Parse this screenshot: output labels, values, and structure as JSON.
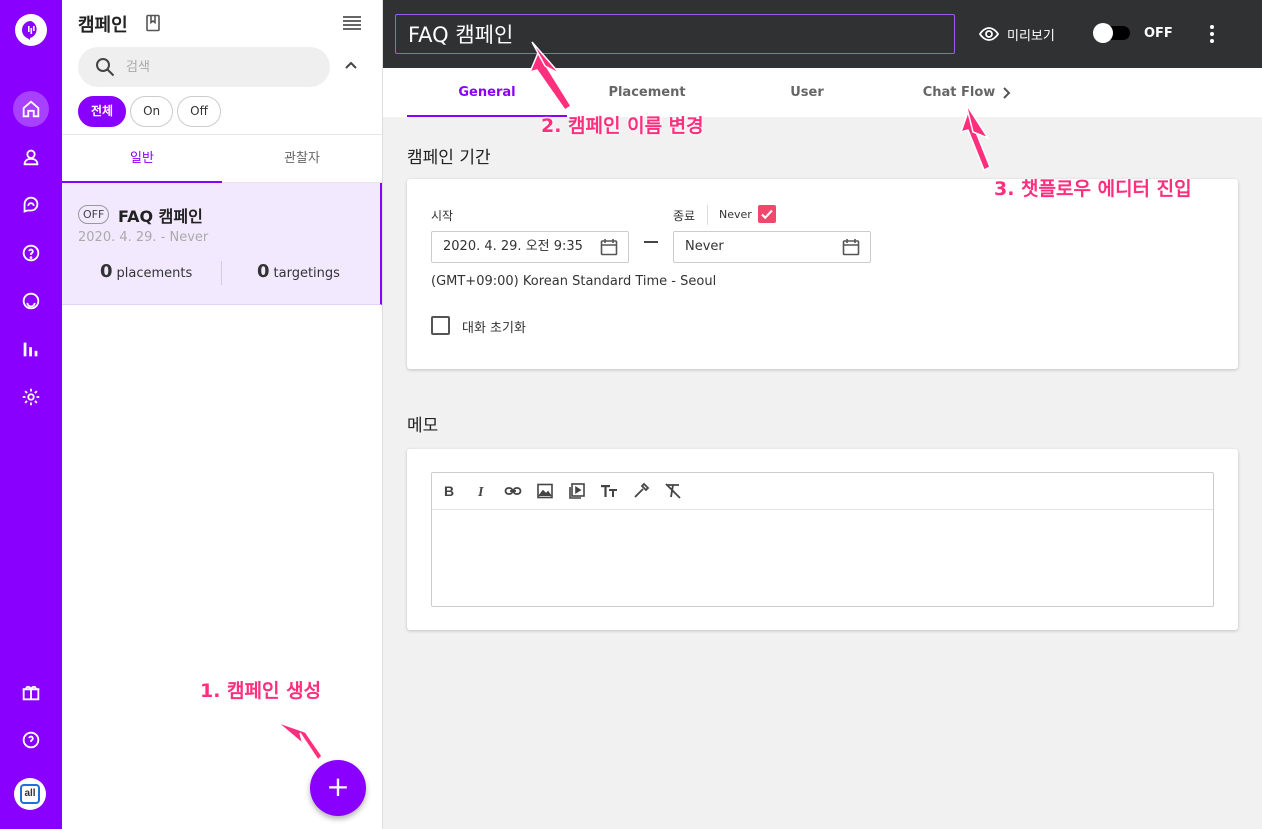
{
  "rail": {
    "items": [
      "home",
      "user",
      "chat-bubble",
      "faq",
      "search-chat",
      "analytics",
      "settings"
    ],
    "bottom": [
      "gift",
      "help"
    ],
    "avatar_text": "all",
    "accent": "#8a00ff"
  },
  "panel": {
    "title": "캠페인",
    "search_placeholder": "검색",
    "filters": [
      "전체",
      "On",
      "Off"
    ],
    "tabs": [
      "일반",
      "관찰자"
    ],
    "campaign": {
      "status": "OFF",
      "name": "FAQ 캠페인",
      "date": "2020. 4. 29. - Never",
      "placements_count": "0",
      "placements_label": "placements",
      "targetings_count": "0",
      "targetings_label": "targetings"
    },
    "add_label": "+"
  },
  "topbar": {
    "title_value": "FAQ 캠페인",
    "preview_label": "미리보기",
    "toggle_label": "OFF"
  },
  "tabs": [
    "General",
    "Placement",
    "User",
    "Chat Flow"
  ],
  "period": {
    "section_title": "캠페인 기간",
    "start_label": "시작",
    "start_value": "2020. 4. 29. 오전 9:35",
    "end_label": "종료",
    "never_label": "Never",
    "end_value": "Never",
    "timezone": "(GMT+09:00) Korean Standard Time - Seoul",
    "reset_label": "대화 초기화"
  },
  "memo": {
    "section_title": "메모",
    "toolbar": [
      "bold-icon",
      "italic-icon",
      "link-icon",
      "image-icon",
      "video-icon",
      "text-size-icon",
      "color-picker-icon",
      "clear-format-icon"
    ]
  },
  "annotations": {
    "a1": "1. 캠페인 생성",
    "a2": "2. 캠페인 이름 변경",
    "a3": "3. 챗플로우 에디터 진입",
    "color": "#ff2f7e"
  }
}
